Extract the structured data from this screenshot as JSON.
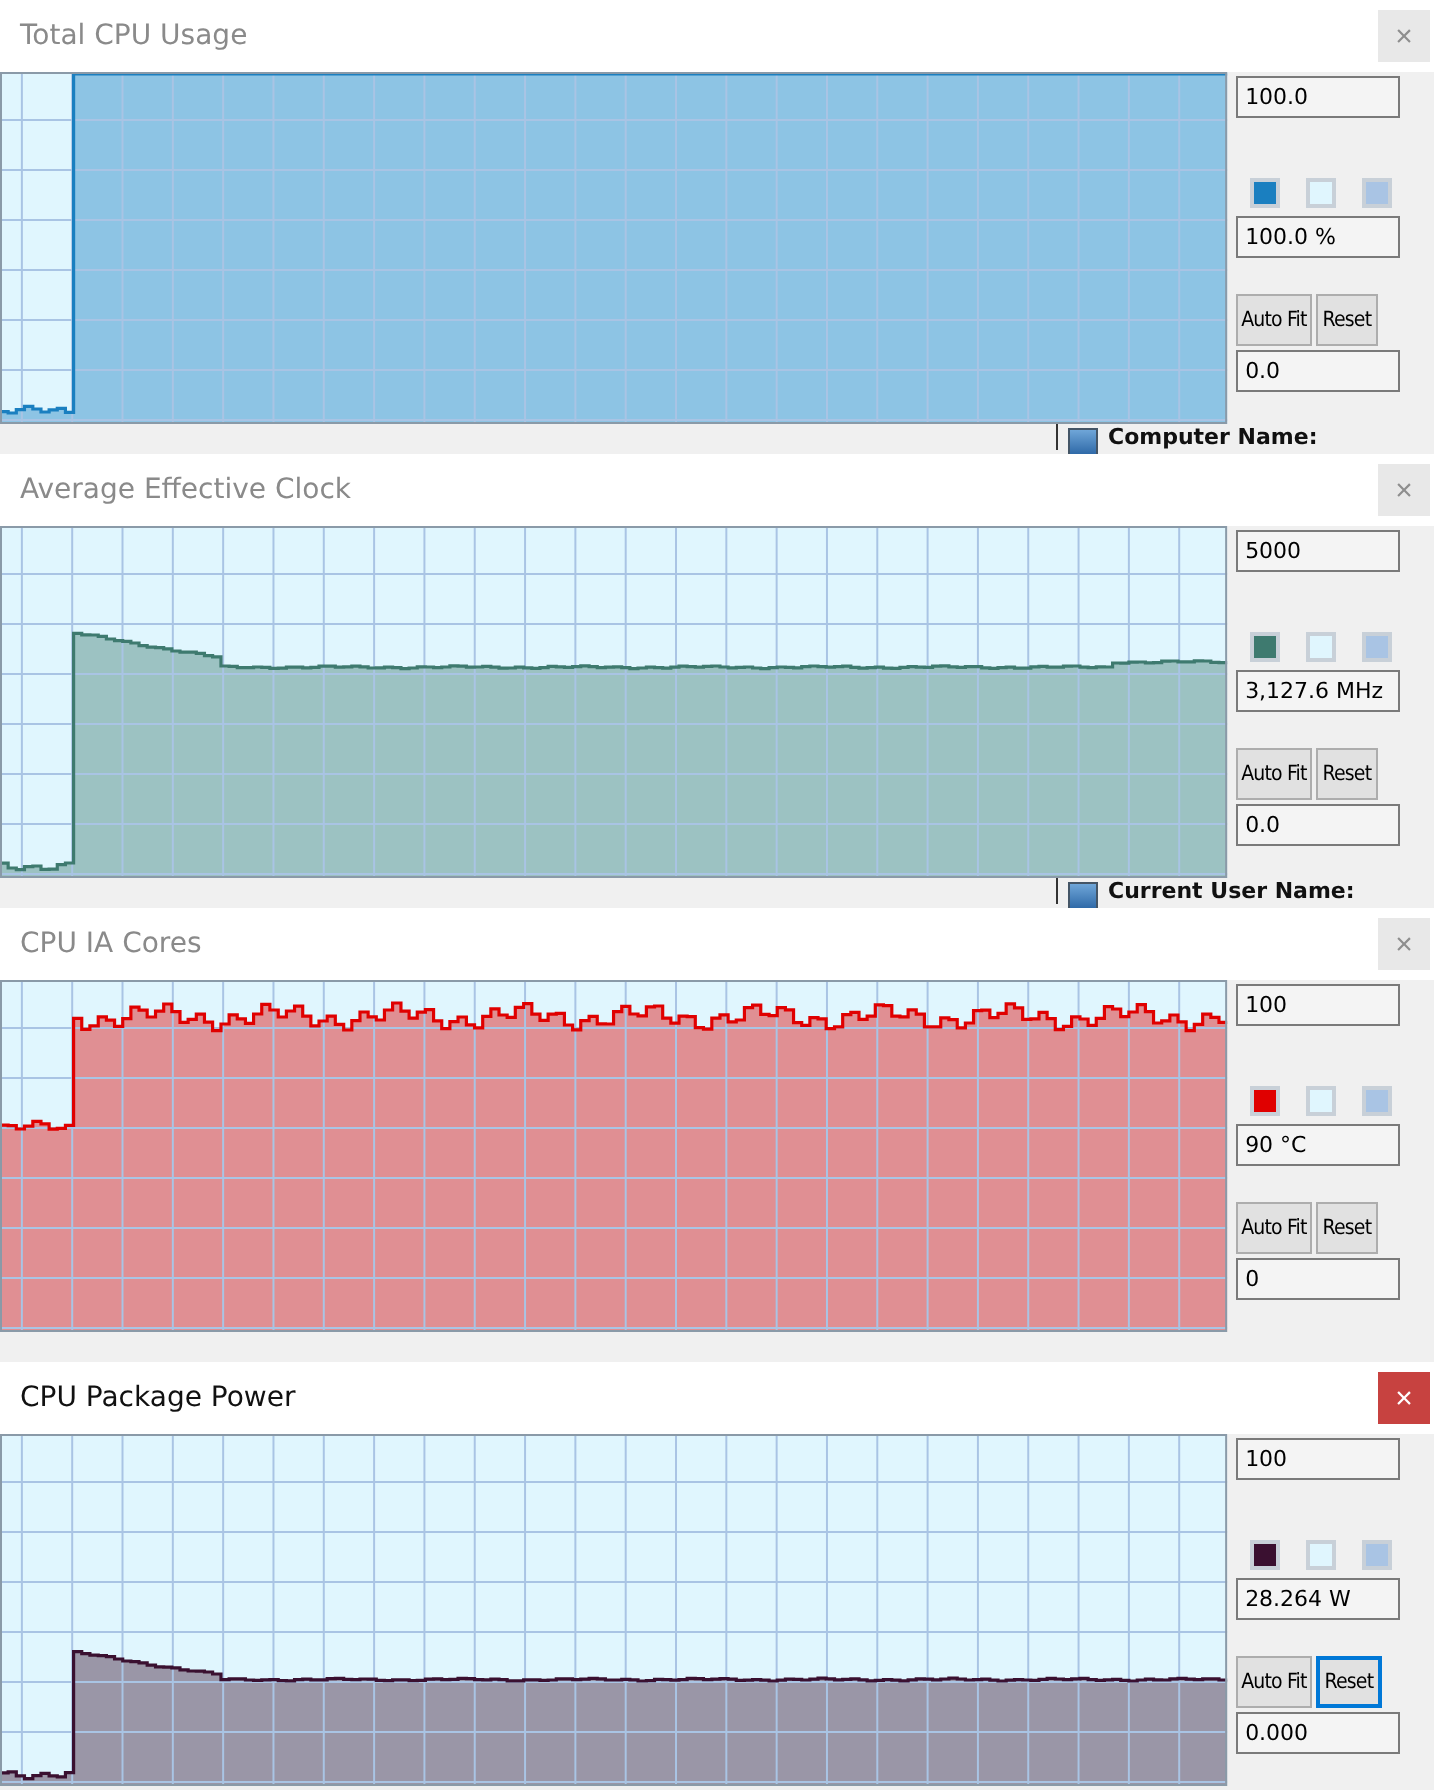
{
  "windows": [
    {
      "title": "Total CPU Usage",
      "active": false,
      "close": "×",
      "max": "100.0",
      "current": "100.0 %",
      "min": "0.0",
      "swatches": [
        {
          "color": "#1a7fc0"
        },
        {
          "color": "#e0f6fe"
        },
        {
          "color": "#a9c4e4"
        }
      ],
      "buttons": [
        {
          "label": "Auto Fit",
          "focused": false
        },
        {
          "label": "Reset",
          "focused": false
        }
      ],
      "behind_text": "Computer Name:"
    },
    {
      "title": "Average Effective Clock",
      "active": false,
      "close": "×",
      "max": "5000",
      "current": "3,127.6 MHz",
      "min": "0.0",
      "swatches": [
        {
          "color": "#3e7a6f"
        },
        {
          "color": "#e0f6fe"
        },
        {
          "color": "#a9c4e4"
        }
      ],
      "buttons": [
        {
          "label": "Auto Fit",
          "focused": false
        },
        {
          "label": "Reset",
          "focused": false
        }
      ],
      "behind_text": "Current User Name:"
    },
    {
      "title": "CPU IA Cores",
      "active": false,
      "close": "×",
      "max": "100",
      "current": "90 °C",
      "min": "0",
      "swatches": [
        {
          "color": "#e00000"
        },
        {
          "color": "#e0f6fe"
        },
        {
          "color": "#a9c4e4"
        }
      ],
      "buttons": [
        {
          "label": "Auto Fit",
          "focused": false
        },
        {
          "label": "Reset",
          "focused": false
        }
      ]
    },
    {
      "title": "CPU Package Power",
      "active": true,
      "close": "×",
      "max": "100",
      "current": "28.264 W",
      "min": "0.000",
      "swatches": [
        {
          "color": "#3a1030"
        },
        {
          "color": "#e0f6fe"
        },
        {
          "color": "#a9c4e4"
        }
      ],
      "buttons": [
        {
          "label": "Auto Fit",
          "focused": false
        },
        {
          "label": "Reset",
          "focused": true
        }
      ]
    }
  ]
}
